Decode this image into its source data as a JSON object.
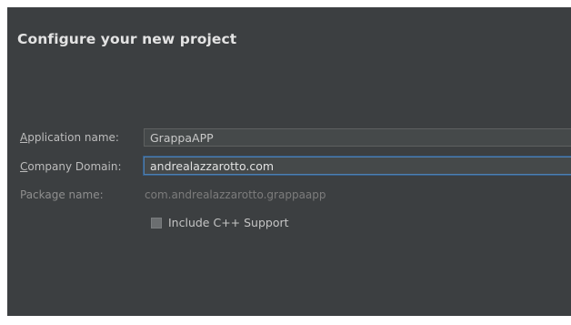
{
  "header": {
    "title": "Configure your new project"
  },
  "form": {
    "application_name": {
      "mnemonic": "A",
      "label_rest": "pplication name:",
      "value": "GrappaAPP"
    },
    "company_domain": {
      "mnemonic": "C",
      "label_rest": "ompany Domain:",
      "value": "andrealazzarotto.com"
    },
    "package_name": {
      "label": "Package name:",
      "value": "com.andrealazzarotto.grappaapp"
    },
    "cpp_support": {
      "label": "Include C++ Support",
      "checked": false
    }
  },
  "colors": {
    "background": "#3c3f41",
    "focus_border": "#4f7fb0"
  }
}
